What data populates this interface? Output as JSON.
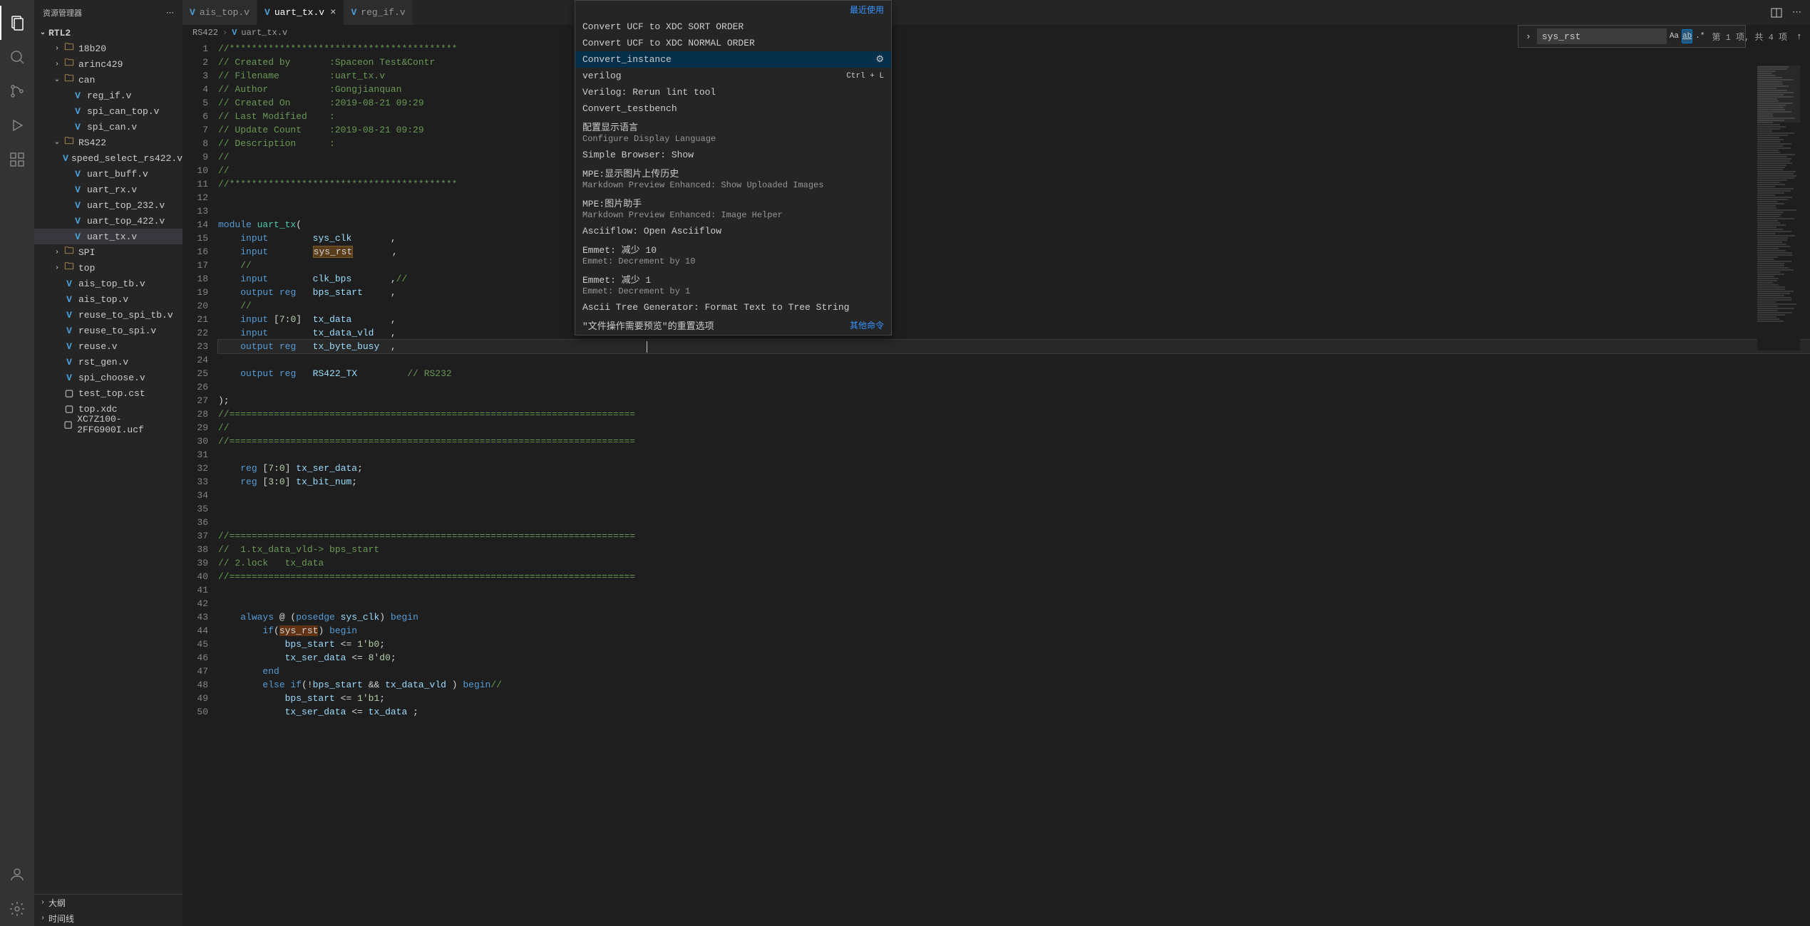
{
  "sidebar": {
    "title": "资源管理器",
    "project": "RTL2",
    "items": [
      {
        "type": "folder",
        "name": "18b20",
        "depth": 2,
        "open": false,
        "chev": "›"
      },
      {
        "type": "folder",
        "name": "arinc429",
        "depth": 2,
        "open": false,
        "chev": "›"
      },
      {
        "type": "folder",
        "name": "can",
        "depth": 2,
        "open": true,
        "chev": "⌄"
      },
      {
        "type": "file",
        "name": "reg_if.v",
        "depth": 3,
        "icon": "V"
      },
      {
        "type": "file",
        "name": "spi_can_top.v",
        "depth": 3,
        "icon": "V"
      },
      {
        "type": "file",
        "name": "spi_can.v",
        "depth": 3,
        "icon": "V"
      },
      {
        "type": "folder",
        "name": "RS422",
        "depth": 2,
        "open": true,
        "chev": "⌄"
      },
      {
        "type": "file",
        "name": "speed_select_rs422.v",
        "depth": 3,
        "icon": "V"
      },
      {
        "type": "file",
        "name": "uart_buff.v",
        "depth": 3,
        "icon": "V"
      },
      {
        "type": "file",
        "name": "uart_rx.v",
        "depth": 3,
        "icon": "V"
      },
      {
        "type": "file",
        "name": "uart_top_232.v",
        "depth": 3,
        "icon": "V"
      },
      {
        "type": "file",
        "name": "uart_top_422.v",
        "depth": 3,
        "icon": "V"
      },
      {
        "type": "file",
        "name": "uart_tx.v",
        "depth": 3,
        "icon": "V",
        "selected": true
      },
      {
        "type": "folder",
        "name": "SPI",
        "depth": 2,
        "open": false,
        "chev": "›"
      },
      {
        "type": "folder",
        "name": "top",
        "depth": 2,
        "open": false,
        "chev": "›"
      },
      {
        "type": "file",
        "name": "ais_top_tb.v",
        "depth": 2,
        "icon": "V"
      },
      {
        "type": "file",
        "name": "ais_top.v",
        "depth": 2,
        "icon": "V"
      },
      {
        "type": "file",
        "name": "reuse_to_spi_tb.v",
        "depth": 2,
        "icon": "V"
      },
      {
        "type": "file",
        "name": "reuse_to_spi.v",
        "depth": 2,
        "icon": "V"
      },
      {
        "type": "file",
        "name": "reuse.v",
        "depth": 2,
        "icon": "V"
      },
      {
        "type": "file",
        "name": "rst_gen.v",
        "depth": 2,
        "icon": "V"
      },
      {
        "type": "file",
        "name": "spi_choose.v",
        "depth": 2,
        "icon": "V"
      },
      {
        "type": "file",
        "name": "test_top.cst",
        "depth": 2,
        "icon": "▢"
      },
      {
        "type": "file",
        "name": "top.xdc",
        "depth": 2,
        "icon": "▢"
      },
      {
        "type": "file",
        "name": "XC7Z100-2FFG900I.ucf",
        "depth": 2,
        "icon": "▢"
      }
    ],
    "footer": [
      {
        "name": "大纲",
        "chev": "›"
      },
      {
        "name": "时间线",
        "chev": "›"
      }
    ]
  },
  "tabs": [
    {
      "name": "ais_top.v",
      "icon": "V",
      "active": false
    },
    {
      "name": "uart_tx.v",
      "icon": "V",
      "active": true
    },
    {
      "name": "reg_if.v",
      "icon": "V",
      "active": false
    }
  ],
  "breadcrumb": {
    "seg1": "RS422",
    "seg2": "uart_tx.v"
  },
  "palette": {
    "recent_label": "最近使用",
    "other_label": "其他命令",
    "items": [
      {
        "title": "Convert UCF to XDC SORT ORDER"
      },
      {
        "title": "Convert UCF to XDC NORMAL ORDER"
      },
      {
        "title": "Convert_instance",
        "selected": true,
        "gear": true
      },
      {
        "title": "verilog",
        "shortcut": "Ctrl  +  L"
      },
      {
        "title": "Verilog: Rerun lint tool"
      },
      {
        "title": "Convert_testbench"
      },
      {
        "title": "配置显示语言",
        "sub": "Configure Display Language"
      },
      {
        "title": "Simple Browser: Show"
      },
      {
        "title": "MPE:显示图片上传历史",
        "sub": "Markdown Preview Enhanced: Show Uploaded Images"
      },
      {
        "title": "MPE:图片助手",
        "sub": "Markdown Preview Enhanced: Image Helper"
      },
      {
        "title": "Asciiflow: Open Asciiflow"
      },
      {
        "title": "Emmet: 减少 10",
        "sub": "Emmet: Decrement by 10"
      },
      {
        "title": "Emmet: 减少 1",
        "sub": "Emmet: Decrement by 1"
      },
      {
        "title": "Ascii Tree Generator: Format Text to Tree String"
      },
      {
        "title": "\"文件操作需要预览\"的重置选项"
      }
    ]
  },
  "find": {
    "value": "sys_rst",
    "result": "第 1 项, 共 4 项"
  },
  "code": {
    "lines": [
      {
        "n": 1,
        "html": "<span class='comment'>//*****************************************"
      },
      {
        "n": 2,
        "html": "<span class='comment'>// Created by       :Spaceon Test&Contr</span>"
      },
      {
        "n": 3,
        "html": "<span class='comment'>// Filename         :uart_tx.v</span>"
      },
      {
        "n": 4,
        "html": "<span class='comment'>// Author           :Gongjianquan</span>"
      },
      {
        "n": 5,
        "html": "<span class='comment'>// Created On       :2019-08-21 09:29</span>"
      },
      {
        "n": 6,
        "html": "<span class='comment'>// Last Modified    :</span>"
      },
      {
        "n": 7,
        "html": "<span class='comment'>// Update Count     :2019-08-21 09:29</span>"
      },
      {
        "n": 8,
        "html": "<span class='comment'>// Description      :</span>"
      },
      {
        "n": 9,
        "html": "<span class='comment'>//</span>"
      },
      {
        "n": 10,
        "html": "<span class='comment'>//</span>"
      },
      {
        "n": 11,
        "html": "<span class='comment'>//*****************************************"
      },
      {
        "n": 12,
        "html": ""
      },
      {
        "n": 13,
        "html": ""
      },
      {
        "n": 14,
        "html": "<span class='kw-blue'>module</span> <span class='kw-teal'>uart_tx</span>("
      },
      {
        "n": 15,
        "html": "    <span class='kw-blue'>input</span>        <span class='ident'>sys_clk</span>       ,"
      },
      {
        "n": 16,
        "html": "    <span class='kw-blue'>input</span>        <span class='highlight-box'>sys_rst</span>       ,"
      },
      {
        "n": 17,
        "html": "    <span class='comment'>//</span>"
      },
      {
        "n": 18,
        "html": "    <span class='kw-blue'>input</span>        <span class='ident'>clk_bps</span>       ,<span class='comment'>//</span>"
      },
      {
        "n": 19,
        "html": "    <span class='kw-blue'>output</span> <span class='kw-blue'>reg</span>   <span class='ident'>bps_start</span>     ,"
      },
      {
        "n": 20,
        "html": "    <span class='comment'>//</span>"
      },
      {
        "n": 21,
        "html": "    <span class='kw-blue'>input</span> [<span class='num'>7</span>:<span class='num'>0</span>]  <span class='ident'>tx_data</span>       ,"
      },
      {
        "n": 22,
        "html": "    <span class='kw-blue'>input</span>        <span class='ident'>tx_data_vld</span>   ,"
      },
      {
        "n": 23,
        "html": "    <span class='kw-blue'>output</span> <span class='kw-blue'>reg</span>   <span class='ident'>tx_byte_busy</span>  ,                                             <span class='cursor-caret'></span>",
        "current": true
      },
      {
        "n": 24,
        "html": ""
      },
      {
        "n": 25,
        "html": "    <span class='kw-blue'>output</span> <span class='kw-blue'>reg</span>   <span class='ident'>RS422_TX</span>         <span class='comment'>// RS232</span>"
      },
      {
        "n": 26,
        "html": ""
      },
      {
        "n": 27,
        "html": ");"
      },
      {
        "n": 28,
        "html": "<span class='comment'>//=========================================================================</span>"
      },
      {
        "n": 29,
        "html": "<span class='comment'>//</span>"
      },
      {
        "n": 30,
        "html": "<span class='comment'>//=========================================================================</span>"
      },
      {
        "n": 31,
        "html": ""
      },
      {
        "n": 32,
        "html": "    <span class='kw-blue'>reg</span> [<span class='num'>7</span>:<span class='num'>0</span>] <span class='ident'>tx_ser_data</span>;"
      },
      {
        "n": 33,
        "html": "    <span class='kw-blue'>reg</span> [<span class='num'>3</span>:<span class='num'>0</span>] <span class='ident'>tx_bit_num</span>;"
      },
      {
        "n": 34,
        "html": ""
      },
      {
        "n": 35,
        "html": ""
      },
      {
        "n": 36,
        "html": ""
      },
      {
        "n": 37,
        "html": "<span class='comment'>//=========================================================================</span>"
      },
      {
        "n": 38,
        "html": "<span class='comment'>//  1.tx_data_vld-> bps_start</span>"
      },
      {
        "n": 39,
        "html": "<span class='comment'>// 2.lock   tx_data</span>"
      },
      {
        "n": 40,
        "html": "<span class='comment'>//=========================================================================</span>"
      },
      {
        "n": 41,
        "html": ""
      },
      {
        "n": 42,
        "html": ""
      },
      {
        "n": 43,
        "html": "    <span class='kw-blue'>always</span> @ (<span class='kw-blue'>posedge</span> <span class='ident'>sys_clk</span>) <span class='kw-blue'>begin</span>"
      },
      {
        "n": 44,
        "html": "        <span class='kw-blue'>if</span>(<span class='highlight-match'>sys_rst</span>) <span class='kw-blue'>begin</span>"
      },
      {
        "n": 45,
        "html": "            <span class='ident'>bps_start</span> <= <span class='num'>1'b0</span>;"
      },
      {
        "n": 46,
        "html": "            <span class='ident'>tx_ser_data</span> <= <span class='num'>8'd0</span>;"
      },
      {
        "n": 47,
        "html": "        <span class='kw-blue'>end</span>"
      },
      {
        "n": 48,
        "html": "        <span class='kw-blue'>else</span> <span class='kw-blue'>if</span>(!<span class='ident'>bps_start</span> && <span class='ident'>tx_data_vld</span> ) <span class='kw-blue'>begin</span><span class='comment'>//</span>"
      },
      {
        "n": 49,
        "html": "            <span class='ident'>bps_start</span> <= <span class='num'>1'b1</span>;"
      },
      {
        "n": 50,
        "html": "            <span class='ident'>tx_ser_data</span> <= <span class='ident'>tx_data</span> ;"
      }
    ]
  }
}
